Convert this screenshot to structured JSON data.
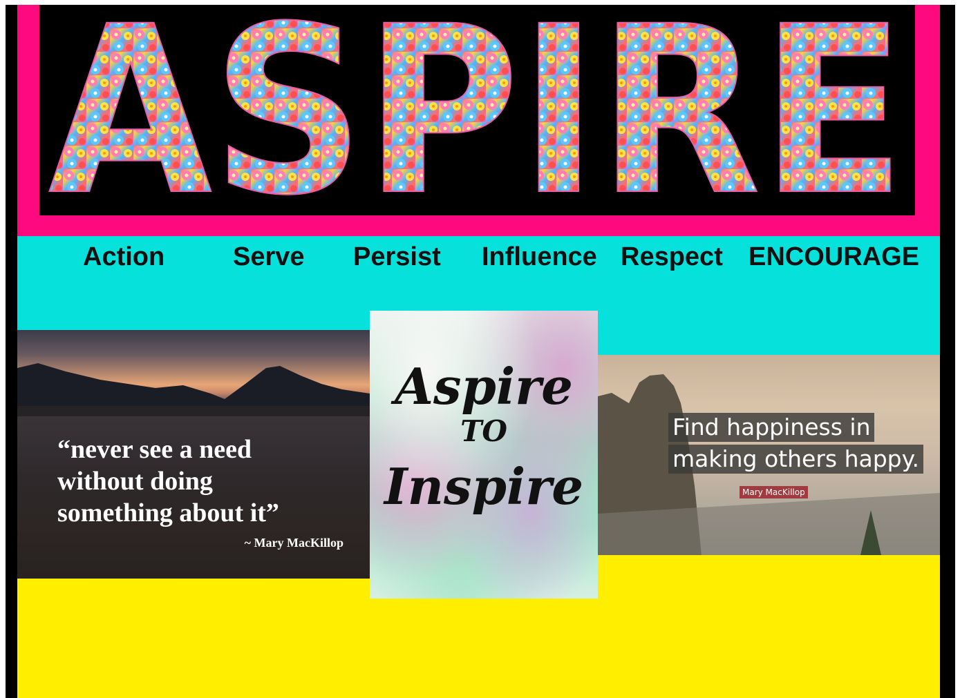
{
  "banner": {
    "title": "ASPIRE",
    "colors": {
      "border": "#ff0a7e",
      "background": "#000000"
    }
  },
  "values_bar": {
    "background": "#07e1dc",
    "words": [
      "Action",
      "Serve",
      "Persist",
      "Influence",
      "Respect",
      "ENCOURAGE"
    ]
  },
  "quote_left": {
    "lines": [
      "“never see a need",
      "without doing",
      "something about it”"
    ],
    "author": "~ Mary MacKillop"
  },
  "poster": {
    "lines": [
      "Aspire",
      "TO",
      "Inspire"
    ]
  },
  "quote_right": {
    "lines": [
      "Find happiness in",
      "making others happy."
    ],
    "author": "Mary MacKillop"
  },
  "footer": {
    "background": "#ffee00"
  }
}
